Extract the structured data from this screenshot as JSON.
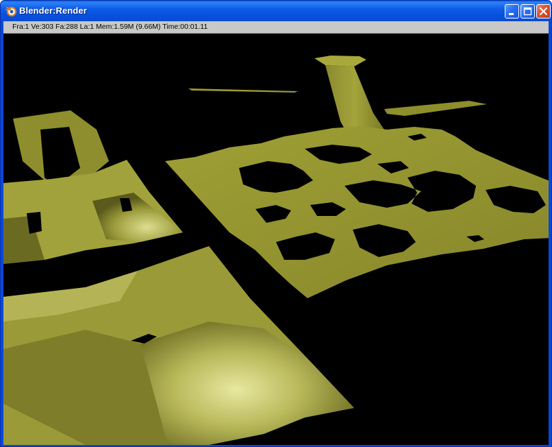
{
  "window": {
    "title": "Blender:Render",
    "app_icon": "blender-icon",
    "controls": [
      "minimize-icon",
      "maximize-icon",
      "close-icon"
    ]
  },
  "status": {
    "text": "Fra:1  Ve:303 Fa:288 La:1 Mem:1.59M (9.66M) Time:00:01.11"
  },
  "render": {
    "background_color": "#000000",
    "mesh_color": "#8c8c28"
  },
  "colors": {
    "titlebar": "#0a5fe8",
    "status_bar": "#c8c8c8",
    "close_button": "#e0502a"
  }
}
